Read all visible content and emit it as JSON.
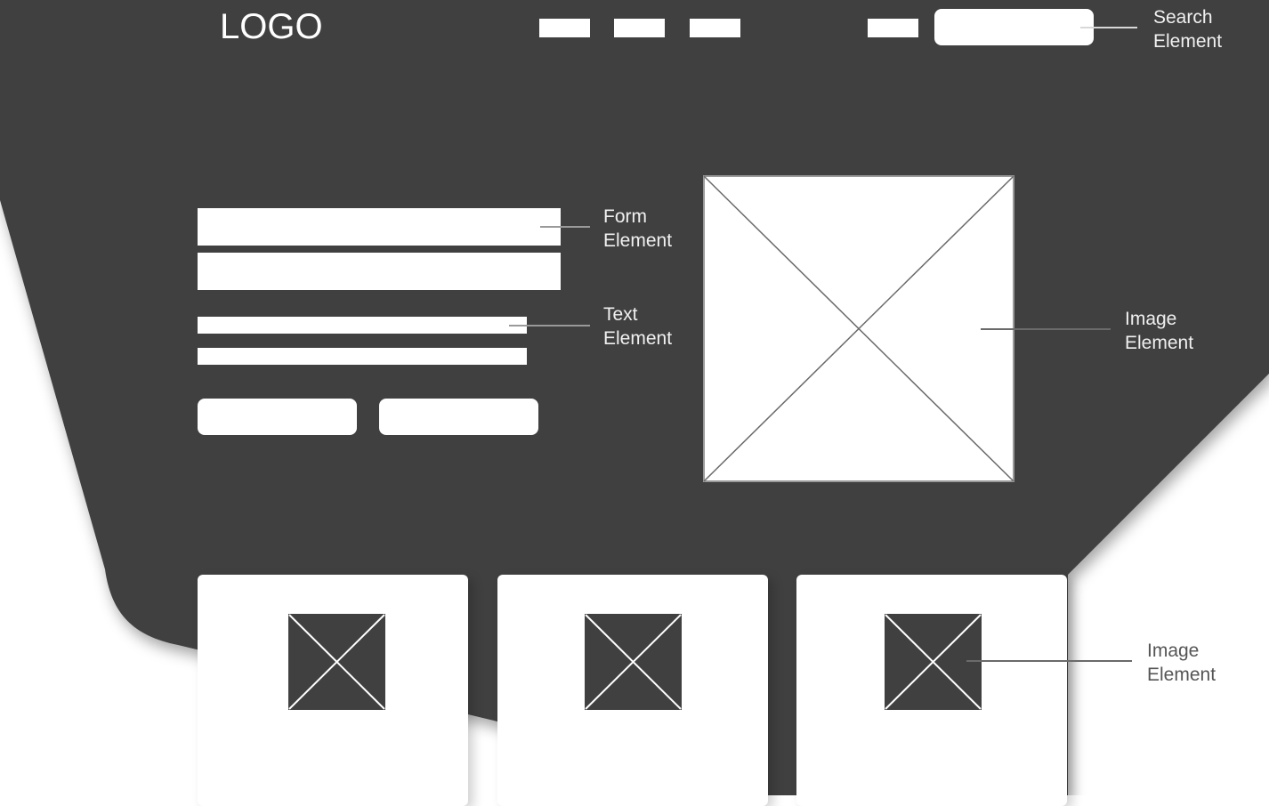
{
  "colors": {
    "background_shape": "#404040",
    "page": "#ffffff",
    "placeholder": "#ffffff",
    "annotation_on_dark": "#f0f0f0",
    "annotation_on_light": "#555555"
  },
  "header": {
    "logo": "LOGO",
    "nav_items": [
      "nav-item-1",
      "nav-item-2",
      "nav-item-3",
      "nav-item-4"
    ],
    "search_icon": "search-box-placeholder"
  },
  "annotations": {
    "search": [
      "Search",
      "Element"
    ],
    "form": [
      "Form",
      "Element"
    ],
    "text": [
      "Text",
      "Element"
    ],
    "image_hero": [
      "Image",
      "Element"
    ],
    "image_cards": [
      "Image",
      "Element"
    ]
  },
  "hero": {
    "form_fields": 2,
    "text_lines": 2,
    "buttons": 2,
    "image_icon": "image-placeholder-icon"
  },
  "cards": {
    "count": 3,
    "image_icon": "image-placeholder-icon"
  }
}
